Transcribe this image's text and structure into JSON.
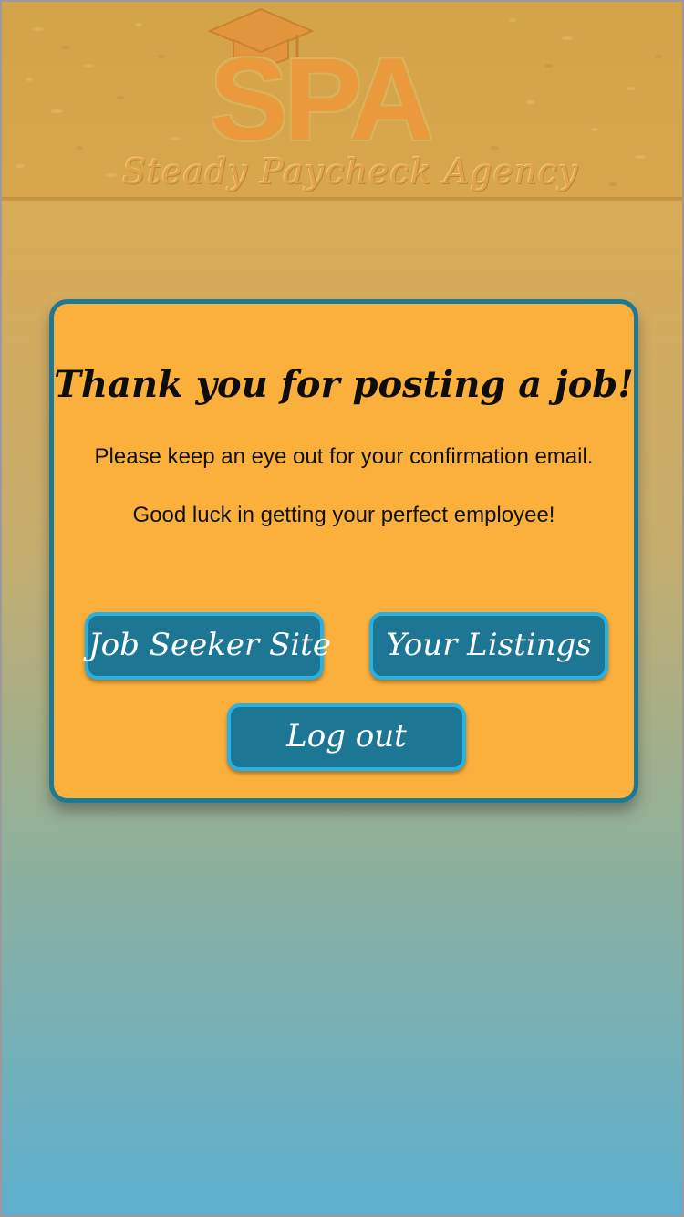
{
  "header": {
    "logo": {
      "mark": "SPA",
      "tagline": "Steady Paycheck Agency",
      "icon": "graduation-cap-icon",
      "color": "#ea9a3c"
    }
  },
  "dialog": {
    "title": "Thank you for posting a job!",
    "message_line1": "Please keep an eye out for your confirmation email.",
    "message_line2": "Good luck in getting your perfect employee!",
    "buttons": {
      "job_seeker_site": "Job Seeker Site",
      "your_listings": "Your Listings",
      "log_out": "Log out"
    }
  },
  "colors": {
    "dialog_background": "#fbb03c",
    "dialog_border": "#1c7a96",
    "button_fill": "#1d7794",
    "button_border": "#27b2e3",
    "page_top": "#e1ab52",
    "page_bottom": "#5db0cf"
  }
}
